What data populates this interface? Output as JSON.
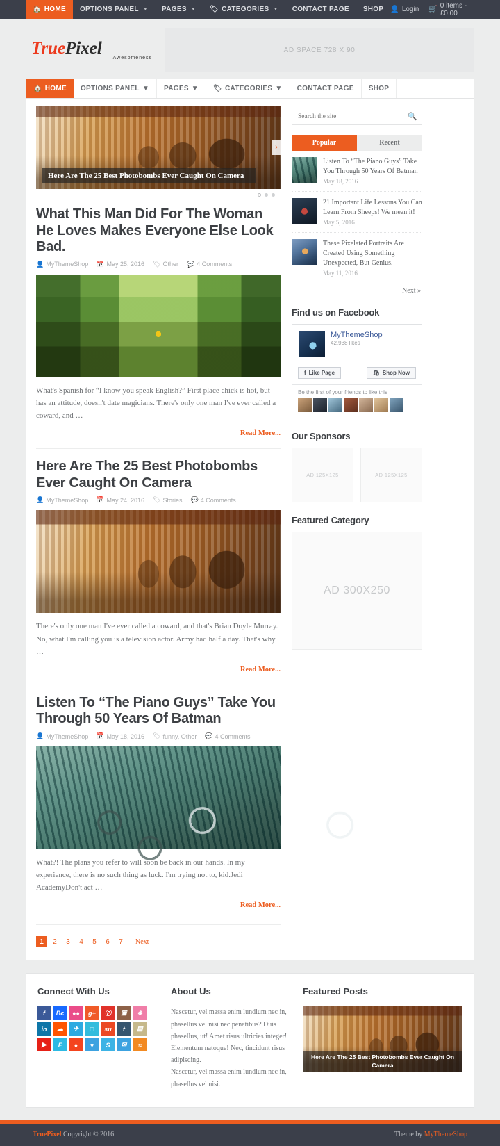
{
  "topbar": {
    "nav": [
      {
        "label": "HOME",
        "icon": "home-icon",
        "active": true,
        "caret": false
      },
      {
        "label": "OPTIONS PANEL",
        "icon": "",
        "active": false,
        "caret": true
      },
      {
        "label": "PAGES",
        "icon": "",
        "active": false,
        "caret": true
      },
      {
        "label": "CATEGORIES",
        "icon": "tag-icon",
        "active": false,
        "caret": true
      },
      {
        "label": "CONTACT PAGE",
        "icon": "",
        "active": false,
        "caret": false
      },
      {
        "label": "SHOP",
        "icon": "",
        "active": false,
        "caret": false
      }
    ],
    "login_label": "Login",
    "cart_label": "0 items - £0.00"
  },
  "header": {
    "logo_part1": "True",
    "logo_part2": "Pixel",
    "logo_tagline": "Awesomeness",
    "ad_label": "AD SPACE 728 X 90"
  },
  "mainnav": [
    {
      "label": "HOME",
      "icon": "home-icon",
      "active": true,
      "caret": false
    },
    {
      "label": "OPTIONS PANEL",
      "icon": "",
      "active": false,
      "caret": true
    },
    {
      "label": "PAGES",
      "icon": "",
      "active": false,
      "caret": true
    },
    {
      "label": "CATEGORIES",
      "icon": "tag-icon",
      "active": false,
      "caret": true
    },
    {
      "label": "CONTACT PAGE",
      "icon": "",
      "active": false,
      "caret": false
    },
    {
      "label": "SHOP",
      "icon": "",
      "active": false,
      "caret": false
    }
  ],
  "slider": {
    "caption": "Here Are The 25 Best Photobombs Ever Caught On Camera",
    "arrow": "›",
    "dots": 3,
    "active_dot": 0
  },
  "posts": [
    {
      "title": "What This Man Did For The Woman He Loves Makes Everyone Else Look Bad.",
      "author": "MyThemeShop",
      "date": "May 25, 2016",
      "category": "Other",
      "comments": "4 Comments",
      "excerpt": "What's Spanish for “I know you speak English?” First place chick is hot, but has an attitude, doesn't date magicians. There's only one man I've ever called a coward, and …",
      "readmore": "Read More...",
      "image": "img-forest"
    },
    {
      "title": "Here Are The 25 Best Photobombs Ever Caught On Camera",
      "author": "MyThemeShop",
      "date": "May 24, 2016",
      "category": "Stories",
      "comments": "4 Comments",
      "excerpt": "There's only one man I've ever called a coward, and that's Brian Doyle Murray. No, what I'm calling you is a television actor. Army had half a day. That's why …",
      "readmore": "Read More...",
      "image": "img-temple"
    },
    {
      "title": "Listen To “The Piano Guys” Take You Through 50 Years Of Batman",
      "author": "MyThemeShop",
      "date": "May 18, 2016",
      "category": "funny, Other",
      "comments": "4 Comments",
      "excerpt": "What?! The plans you refer to will soon be back in our hands. In my experience, there is no such thing as luck. I'm trying not to, kid.Jedi AcademyDon't act …",
      "readmore": "Read More...",
      "image": "img-bike"
    }
  ],
  "pagination": {
    "pages": [
      "1",
      "2",
      "3",
      "4",
      "5",
      "6",
      "7"
    ],
    "current": "1",
    "next_label": "Next"
  },
  "sidebar": {
    "search_placeholder": "Search the site",
    "tabs": [
      {
        "label": "Popular",
        "active": true
      },
      {
        "label": "Recent",
        "active": false
      }
    ],
    "popular_posts": [
      {
        "title": "Listen To “The Piano Guys” Take You Through 50 Years Of Batman",
        "date": "May 18, 2016",
        "image": "img-bike"
      },
      {
        "title": "21 Important Life Lessons You Can Learn From Sheeps! We mean it!",
        "date": "May 5, 2016",
        "image": "img-sheep"
      },
      {
        "title": "These Pixelated Portraits Are Created Using Something Unexpected, But Genius.",
        "date": "May 11, 2016",
        "image": "img-portrait"
      }
    ],
    "next_label": "Next »",
    "facebook": {
      "widget_title": "Find us on Facebook",
      "page_name": "MyThemeShop",
      "likes": "42,938 likes",
      "like_button": "Like Page",
      "shop_button": "Shop Now",
      "friends_text": "Be the first of your friends to like this"
    },
    "sponsors": {
      "title": "Our Sponsors",
      "ads": [
        "AD 125X125",
        "AD 125X125"
      ]
    },
    "featured_category": {
      "title": "Featured Category",
      "ad": "AD 300X250"
    }
  },
  "footer": {
    "connect": {
      "title": "Connect With Us",
      "icons": [
        {
          "name": "facebook-icon",
          "glyph": "f",
          "color": "#3b5998"
        },
        {
          "name": "behance-icon",
          "glyph": "Bє",
          "color": "#1769ff"
        },
        {
          "name": "dribbble-icon",
          "glyph": "●●",
          "color": "#ea4c89"
        },
        {
          "name": "google-plus-icon",
          "glyph": "g+",
          "color": "#f05a28"
        },
        {
          "name": "pinterest-icon",
          "glyph": "Ⓟ",
          "color": "#e1322a"
        },
        {
          "name": "instagram-icon",
          "glyph": "▣",
          "color": "#8d6148"
        },
        {
          "name": "dropbox-icon",
          "glyph": "◈",
          "color": "#f07ea8"
        },
        {
          "name": "linkedin-icon",
          "glyph": "in",
          "color": "#0e76a8"
        },
        {
          "name": "soundcloud-icon",
          "glyph": "☁",
          "color": "#ff5500"
        },
        {
          "name": "twitter-icon",
          "glyph": "✈",
          "color": "#2daae1"
        },
        {
          "name": "vimeo-icon",
          "glyph": "□",
          "color": "#33bcdd"
        },
        {
          "name": "stumbleupon-icon",
          "glyph": "su",
          "color": "#eb4924"
        },
        {
          "name": "tumblr-icon",
          "glyph": "t",
          "color": "#35556f"
        },
        {
          "name": "xing-icon",
          "glyph": "▤",
          "color": "#c6b98b"
        },
        {
          "name": "youtube-icon",
          "glyph": "▶",
          "color": "#e62117"
        },
        {
          "name": "foursquare-icon",
          "glyph": "F",
          "color": "#2dbae4"
        },
        {
          "name": "rss-orange-icon",
          "glyph": "●",
          "color": "#f4441e"
        },
        {
          "name": "flickr-icon",
          "glyph": "♥",
          "color": "#3ca2e0"
        },
        {
          "name": "skype-icon",
          "glyph": "S",
          "color": "#3cb3e5"
        },
        {
          "name": "email-icon",
          "glyph": "✉",
          "color": "#3ca2e0"
        },
        {
          "name": "rss-icon",
          "glyph": "≈",
          "color": "#f28a22"
        }
      ]
    },
    "about": {
      "title": "About Us",
      "text": "Nascetur, vel massa enim lundium nec in, phasellus vel nisi nec penatibus? Duis phasellus, ut! Amet risus ultricies integer! Elementum natoque! Nec, tincidunt risus adipiscing.\nNascetur, vel massa enim lundium nec in, phasellus vel nisi."
    },
    "featured": {
      "title": "Featured Posts",
      "post_caption": "Here Are The 25 Best Photobombs Ever Caught On Camera"
    },
    "bar": {
      "brand": "TruePixel",
      "copyright": "Copyright © 2016.",
      "theme_by": "Theme by ",
      "theme_author": "MyThemeShop"
    }
  }
}
